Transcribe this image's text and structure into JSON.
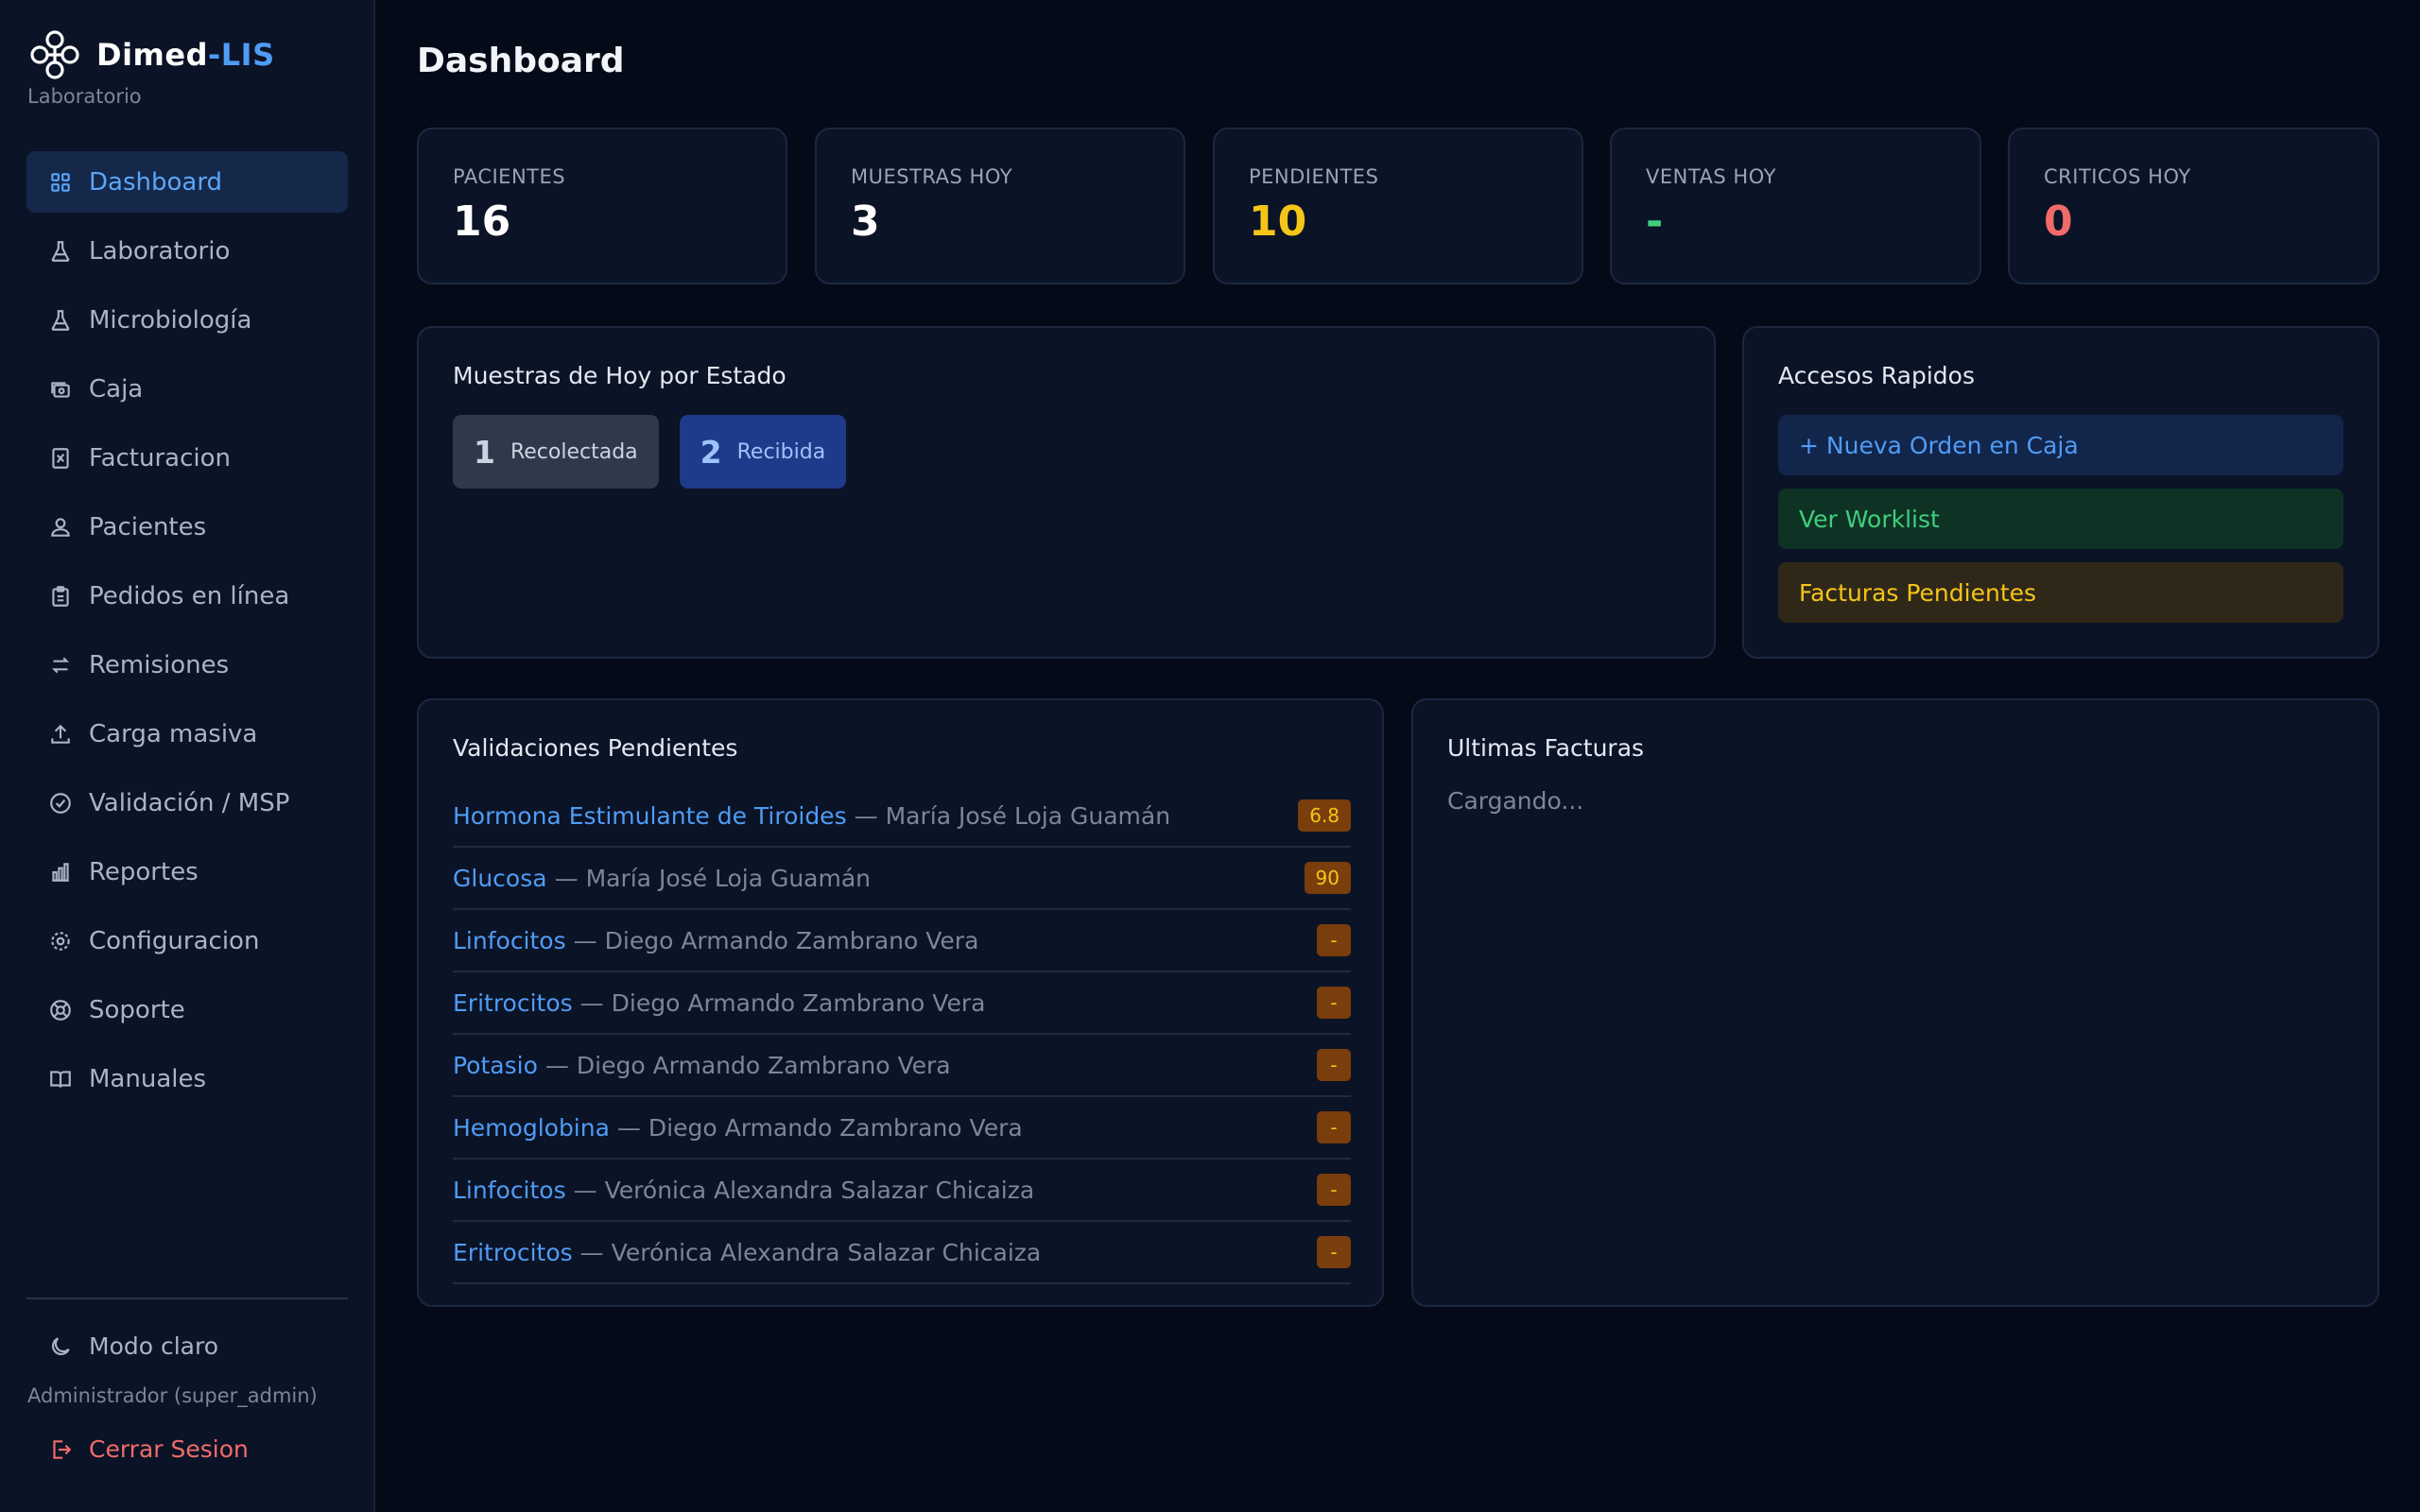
{
  "brand": {
    "name": "Dimed",
    "name_accent": "-LIS",
    "subtitle": "Laboratorio"
  },
  "sidebar": {
    "items": [
      {
        "label": "Dashboard",
        "icon": "grid-icon",
        "active": true
      },
      {
        "label": "Laboratorio",
        "icon": "flask-icon"
      },
      {
        "label": "Microbiología",
        "icon": "flask-icon"
      },
      {
        "label": "Caja",
        "icon": "cash-icon"
      },
      {
        "label": "Facturacion",
        "icon": "receipt-icon"
      },
      {
        "label": "Pacientes",
        "icon": "patient-icon"
      },
      {
        "label": "Pedidos en línea",
        "icon": "clipboard-icon"
      },
      {
        "label": "Remisiones",
        "icon": "transfer-icon"
      },
      {
        "label": "Carga masiva",
        "icon": "upload-icon"
      },
      {
        "label": "Validación / MSP",
        "icon": "check-circle-icon"
      },
      {
        "label": "Reportes",
        "icon": "bar-chart-icon"
      },
      {
        "label": "Configuracion",
        "icon": "gear-icon"
      },
      {
        "label": "Soporte",
        "icon": "support-icon"
      },
      {
        "label": "Manuales",
        "icon": "book-icon"
      }
    ],
    "theme_toggle": "Modo claro",
    "user_role": "Administrador (super_admin)",
    "logout": "Cerrar Sesion"
  },
  "page": {
    "title": "Dashboard"
  },
  "stats": [
    {
      "label": "PACIENTES",
      "value": "16",
      "color": "#ffffff"
    },
    {
      "label": "MUESTRAS HOY",
      "value": "3",
      "color": "#ffffff"
    },
    {
      "label": "PENDIENTES",
      "value": "10",
      "color": "#f5c518"
    },
    {
      "label": "VENTAS HOY",
      "value": "-",
      "color": "#3fcf7c"
    },
    {
      "label": "CRITICOS HOY",
      "value": "0",
      "color": "#f26b6b"
    }
  ],
  "samples_by_state": {
    "title": "Muestras de Hoy por Estado",
    "states": [
      {
        "count": "1",
        "label": "Recolectada"
      },
      {
        "count": "2",
        "label": "Recibida"
      }
    ]
  },
  "quick_access": {
    "title": "Accesos Rapidos",
    "links": [
      {
        "label": "+ Nueva Orden en Caja"
      },
      {
        "label": "Ver Worklist"
      },
      {
        "label": "Facturas Pendientes"
      }
    ]
  },
  "pending_validations": {
    "title": "Validaciones Pendientes",
    "separator": "—",
    "rows": [
      {
        "test": "Hormona Estimulante de Tiroides",
        "patient": "María José Loja Guamán",
        "value": "6.8"
      },
      {
        "test": "Glucosa",
        "patient": "María José Loja Guamán",
        "value": "90"
      },
      {
        "test": "Linfocitos",
        "patient": "Diego Armando Zambrano Vera",
        "value": "-"
      },
      {
        "test": "Eritrocitos",
        "patient": "Diego Armando Zambrano Vera",
        "value": "-"
      },
      {
        "test": "Potasio",
        "patient": "Diego Armando Zambrano Vera",
        "value": "-"
      },
      {
        "test": "Hemoglobina",
        "patient": "Diego Armando Zambrano Vera",
        "value": "-"
      },
      {
        "test": "Linfocitos",
        "patient": "Verónica Alexandra Salazar Chicaiza",
        "value": "-"
      },
      {
        "test": "Eritrocitos",
        "patient": "Verónica Alexandra Salazar Chicaiza",
        "value": "-"
      }
    ]
  },
  "last_invoices": {
    "title": "Ultimas Facturas",
    "status": "Cargando..."
  }
}
